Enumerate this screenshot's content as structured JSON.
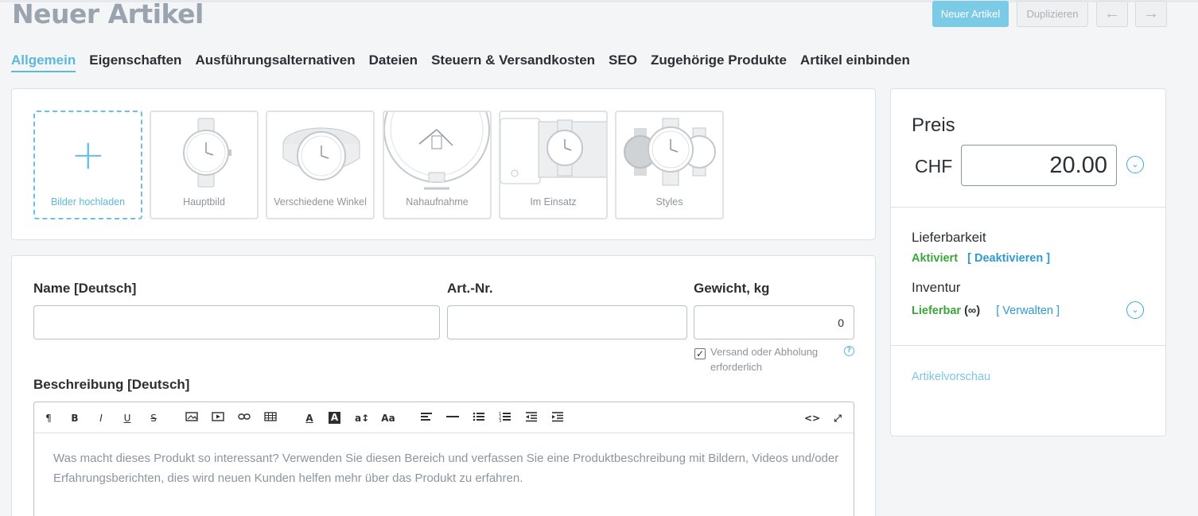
{
  "header": {
    "title": "Neuer Artikel",
    "new_button": "Neuer Artikel",
    "duplicate_button": "Duplizieren",
    "prev_icon": "←",
    "next_icon": "→"
  },
  "tabs": [
    {
      "label": "Allgemein",
      "active": true
    },
    {
      "label": "Eigenschaften"
    },
    {
      "label": "Ausführungsalternativen"
    },
    {
      "label": "Dateien"
    },
    {
      "label": "Steuern & Versandkosten"
    },
    {
      "label": "SEO"
    },
    {
      "label": "Zugehörige Produkte"
    },
    {
      "label": "Artikel einbinden"
    }
  ],
  "images": {
    "upload_label": "Bilder hochladen",
    "upload_icon": "+",
    "slots": [
      {
        "label": "Hauptbild",
        "icon": "watch-front-icon"
      },
      {
        "label": "Verschiedene Winkel",
        "icon": "watch-angle-icon"
      },
      {
        "label": "Nahaufnahme",
        "icon": "watch-closeup-icon"
      },
      {
        "label": "Im Einsatz",
        "icon": "watch-in-use-icon"
      },
      {
        "label": "Styles",
        "icon": "watch-styles-icon"
      }
    ]
  },
  "form": {
    "name_label": "Name [Deutsch]",
    "name_value": "",
    "sku_label": "Art.-Nr.",
    "sku_value": "",
    "weight_label": "Gewicht, kg",
    "weight_value": "0",
    "shipping_checkbox_label": "Versand oder Abholung erforderlich",
    "shipping_checked": true,
    "help_icon": "?",
    "description_label": "Beschreibung [Deutsch]",
    "description_placeholder": "Was macht dieses Produkt so interessant? Verwenden Sie diesen Bereich und verfassen Sie eine Produktbeschreibung mit Bildern, Videos und/oder Erfahrungsberichten, dies wird neuen Kunden helfen mehr über das Produkt zu erfahren."
  },
  "toolbar": {
    "paragraph": "¶",
    "bold": "B",
    "italic": "I",
    "underline": "U",
    "strike": "S",
    "text_color": "A",
    "background_color": "A",
    "font_size": "a↕",
    "font_family": "Aa",
    "code_view": "<>",
    "fullscreen": "⤢"
  },
  "sidebar": {
    "price_title": "Preis",
    "currency": "CHF",
    "price_value": "20.00",
    "availability_title": "Lieferbarkeit",
    "availability_status": "Aktiviert",
    "availability_action": "[ Deaktivieren ]",
    "inventory_title": "Inventur",
    "inventory_status": "Lieferbar",
    "inventory_qty": "(∞)",
    "inventory_action": "[ Verwalten ]",
    "preview_link": "Artikelvorschau",
    "expand_icon": "⌄"
  },
  "colors": {
    "accent": "#5ab9dd",
    "green": "#3aa63a",
    "link_blue": "#2f9ad1",
    "title_gray": "#9aa4ae"
  }
}
